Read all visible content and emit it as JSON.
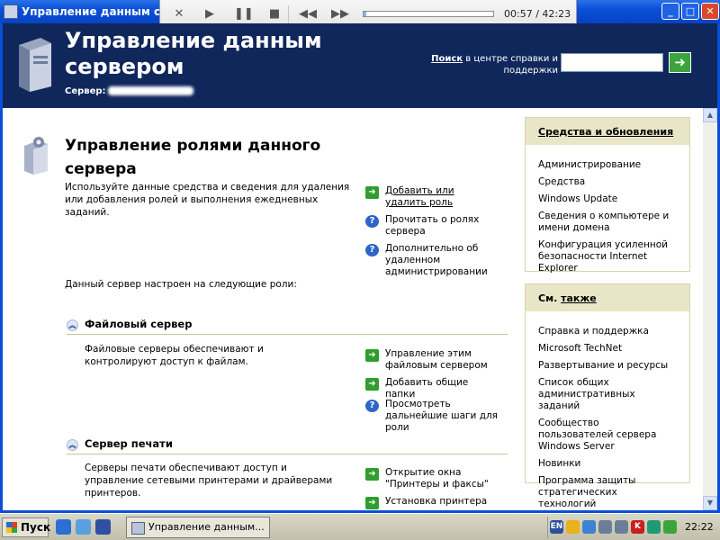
{
  "window": {
    "title": "Управление данным серве",
    "controls": {
      "minimize": "_",
      "maximize": "□",
      "close": "✕"
    }
  },
  "media_player": {
    "icons": [
      "close-icon",
      "play-icon",
      "pause-icon",
      "stop-icon",
      "rewind-icon",
      "fast-forward-icon"
    ],
    "progress": 0.022,
    "time": "00:57 / 42:23"
  },
  "header": {
    "title": "Управление данным сервером",
    "server_label": "Сервер:",
    "search_label_bold": "Поиск",
    "search_label_rest": " в центре справки и поддержки",
    "search_value": ""
  },
  "main": {
    "heading": "Управление ролями данного сервера",
    "intro": "Используйте данные средства и сведения для удаления или добавления ролей и выполнения ежедневных заданий.",
    "top_actions": [
      {
        "icon": "arrow-go-icon",
        "label": "Добавить или удалить роль"
      },
      {
        "icon": "help-icon",
        "label": "Прочитать о ролях сервера"
      },
      {
        "icon": "help-icon",
        "label": "Дополнительно об удаленном администрировании"
      }
    ],
    "configured_text": "Данный сервер настроен на следующие роли:",
    "roles": [
      {
        "title": "Файловый сервер",
        "description": "Файловые серверы обеспечивают и контролируют доступ к файлам.",
        "actions": [
          {
            "icon": "arrow-go-icon",
            "label": "Управление этим файловым сервером"
          },
          {
            "icon": "arrow-go-icon",
            "label": "Добавить общие папки"
          },
          {
            "icon": "help-icon",
            "label": "Просмотреть дальнейшие шаги для роли"
          }
        ]
      },
      {
        "title": "Сервер печати",
        "description": "Серверы печати обеспечивают доступ и управление сетевыми принтерами и драйверами принтеров.",
        "actions": [
          {
            "icon": "arrow-go-icon",
            "label": "Открытие окна \"Принтеры и факсы\""
          },
          {
            "icon": "arrow-go-icon",
            "label": "Установка принтера"
          }
        ]
      }
    ]
  },
  "panels": {
    "tools": {
      "title": "Средства и обновления",
      "items": [
        "Администрирование",
        "Средства",
        "Windows Update",
        "Сведения о компьютере и имени домена",
        "Конфигурация усиленной безопасности Internet Explorer"
      ]
    },
    "see_also": {
      "title_prefix": "См. ",
      "title_underlined": "также",
      "items": [
        "Справка и поддержка",
        "Microsoft TechNet",
        "Развертывание и ресурсы",
        "Список общих административных заданий",
        "Сообщество пользователей сервера Windows Server",
        "Новинки",
        "Программа защиты стратегических технологий"
      ]
    }
  },
  "taskbar": {
    "start_label": "Пуск",
    "task_label": "Управление данным...",
    "language": "EN",
    "clock": "22:22"
  },
  "colors": {
    "header_bg": "#10275c",
    "panel_header_bg": "#e8e6c6",
    "go_green": "#2f9e2f",
    "help_blue": "#2d65c8"
  }
}
